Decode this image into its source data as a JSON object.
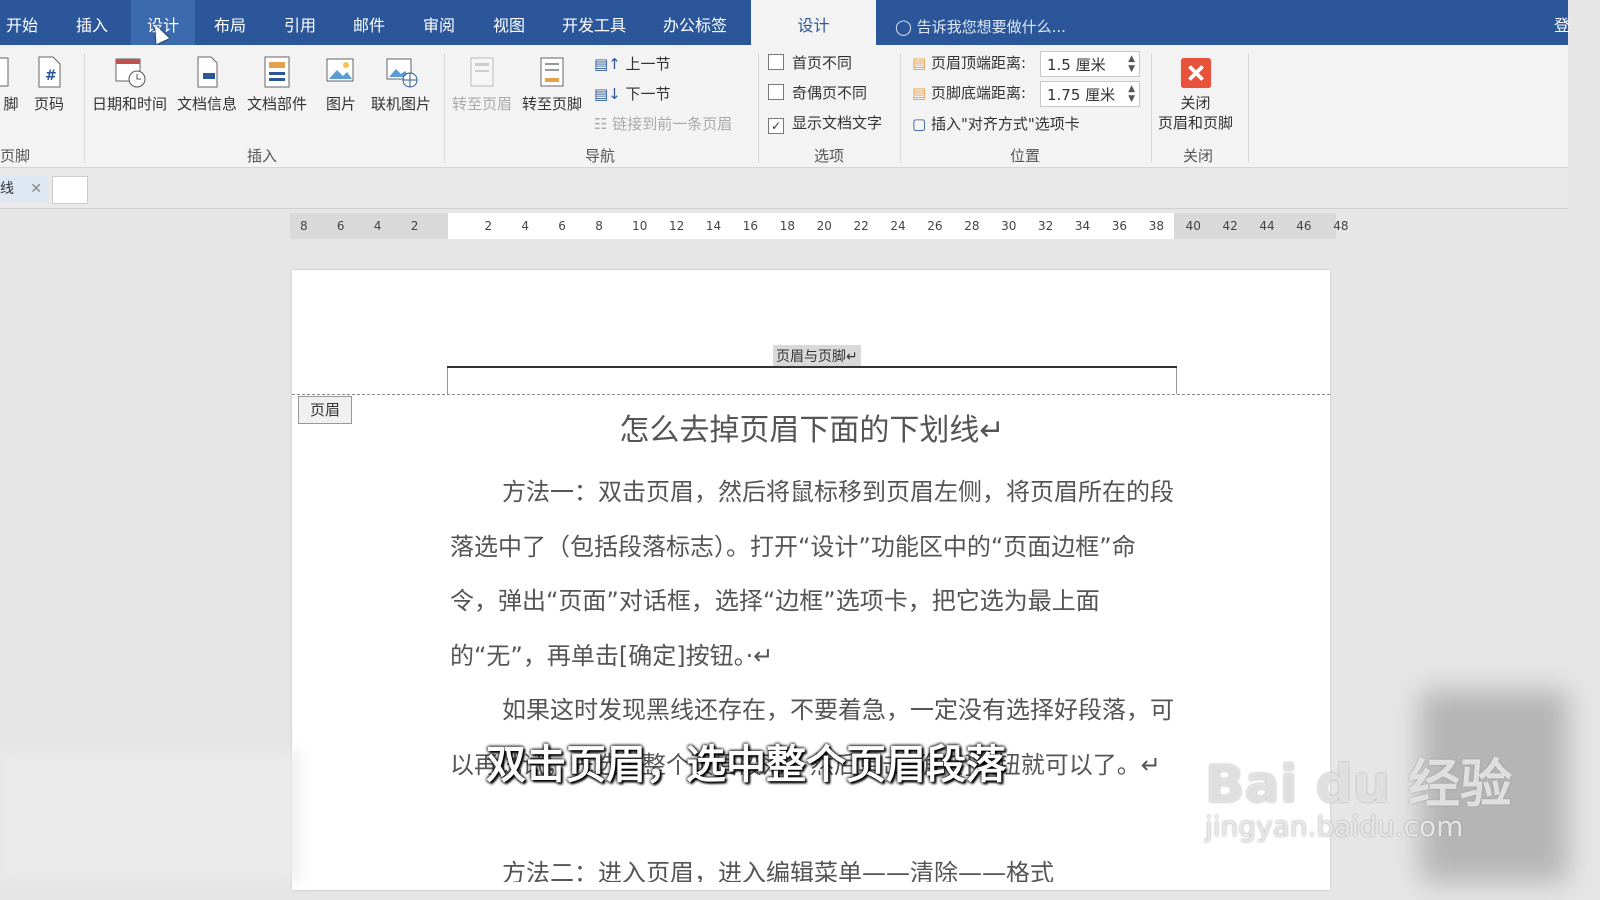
{
  "menu": {
    "tabs": [
      {
        "label": "开始"
      },
      {
        "label": "插入"
      },
      {
        "label": "设计"
      },
      {
        "label": "布局"
      },
      {
        "label": "引用"
      },
      {
        "label": "邮件"
      },
      {
        "label": "审阅"
      },
      {
        "label": "视图"
      },
      {
        "label": "开发工具"
      },
      {
        "label": "办公标签"
      },
      {
        "label": "设计"
      }
    ],
    "tell_me": "告诉我您想要做什么...",
    "login": "登"
  },
  "ribbon": {
    "groups": {
      "header_footer": {
        "label": "页脚",
        "button": "脚"
      },
      "insert": {
        "label": "插入",
        "buttons": [
          "页码",
          "日期和时间",
          "文档信息",
          "文档部件",
          "图片",
          "联机图片"
        ]
      },
      "nav": {
        "label": "导航",
        "buttons": [
          "转至页眉",
          "转至页脚"
        ],
        "small": [
          "上一节",
          "下一节",
          "链接到前一条页眉"
        ]
      },
      "options": {
        "label": "选项",
        "items": [
          "首页不同",
          "奇偶页不同",
          "显示文档文字"
        ]
      },
      "position": {
        "label": "位置",
        "header_label": "页眉顶端距离:",
        "header_value": "1.5 厘米",
        "footer_label": "页脚底端距离:",
        "footer_value": "1.75 厘米",
        "insert_align": "插入\"对齐方式\"选项卡"
      },
      "close": {
        "label": "关闭",
        "button": "关闭\n页眉和页脚"
      }
    }
  },
  "doc_tab": {
    "label": "线"
  },
  "ruler": {
    "ticks": [
      "8",
      "6",
      "4",
      "2",
      "2",
      "4",
      "6",
      "8",
      "10",
      "12",
      "14",
      "16",
      "18",
      "20",
      "22",
      "24",
      "26",
      "28",
      "30",
      "32",
      "34",
      "36",
      "38",
      "40",
      "42",
      "44",
      "46",
      "48"
    ]
  },
  "page": {
    "header_text": "页眉与页脚↵",
    "header_tag": "页眉",
    "title": "怎么去掉页眉下面的下划线↵",
    "paragraphs": [
      "方法一：双击页眉，然后将鼠标移到页眉左侧，将页眉所在的段落选中了（包括段落标志）。打开“设计”功能区中的“页面边框”命令，弹出“页面”对话框，选择“边框”选项卡，把它选为最上面的“无”，再单击[确定]按钮。·↵",
      "如果这时发现黑线还存在，不要着急，一定没有选择好段落，可以再试试，先选中整个页眉段落，然后单击[确定]按钮就可以了。↵",
      "方法二：进入页眉，进入编辑菜单——清除——格式"
    ]
  },
  "subtitle": "双击页眉，选中整个页眉段落",
  "watermark": {
    "brand": "Bai du 经验",
    "url": "jingyan.baidu.com"
  },
  "colors": {
    "word_blue": "#2b579a",
    "close_red": "#e8513a"
  }
}
